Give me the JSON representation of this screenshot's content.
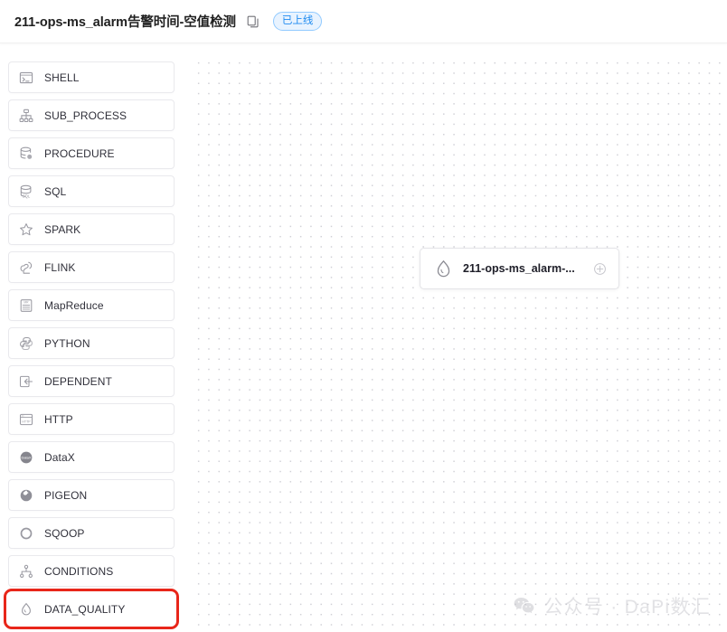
{
  "header": {
    "title": "211-ops-ms_alarm告警时间-空值检测",
    "copy_icon": "copy-icon",
    "status_badge": "已上线",
    "badge_color": "#1e8bf0",
    "badge_bg": "#e8f3ff",
    "badge_border": "#91caff"
  },
  "sidebar": {
    "items": [
      {
        "label": "SHELL",
        "icon": "terminal-icon",
        "highlighted": false
      },
      {
        "label": "SUB_PROCESS",
        "icon": "hierarchy-icon",
        "highlighted": false
      },
      {
        "label": "PROCEDURE",
        "icon": "database-gear-icon",
        "highlighted": false
      },
      {
        "label": "SQL",
        "icon": "database-sql-icon",
        "highlighted": false
      },
      {
        "label": "SPARK",
        "icon": "star-icon",
        "highlighted": false
      },
      {
        "label": "FLINK",
        "icon": "squirrel-icon",
        "highlighted": false
      },
      {
        "label": "MapReduce",
        "icon": "mapreduce-icon",
        "highlighted": false
      },
      {
        "label": "PYTHON",
        "icon": "python-icon",
        "highlighted": false
      },
      {
        "label": "DEPENDENT",
        "icon": "dependent-icon",
        "highlighted": false
      },
      {
        "label": "HTTP",
        "icon": "http-icon",
        "highlighted": false
      },
      {
        "label": "DataX",
        "icon": "datax-icon",
        "highlighted": false
      },
      {
        "label": "PIGEON",
        "icon": "pigeon-icon",
        "highlighted": false
      },
      {
        "label": "SQOOP",
        "icon": "sqoop-circle-icon",
        "highlighted": false
      },
      {
        "label": "CONDITIONS",
        "icon": "conditions-icon",
        "highlighted": false
      },
      {
        "label": "DATA_QUALITY",
        "icon": "water-drop-icon",
        "highlighted": true
      }
    ],
    "highlight_color": "#e8261a"
  },
  "canvas": {
    "nodes": [
      {
        "label": "211-ops-ms_alarm-...",
        "icon": "water-drop-icon",
        "connector": "plus-circle-icon"
      }
    ]
  },
  "watermark": {
    "logo": "wechat-icon",
    "text": "公众号 · DaPi数汇"
  }
}
